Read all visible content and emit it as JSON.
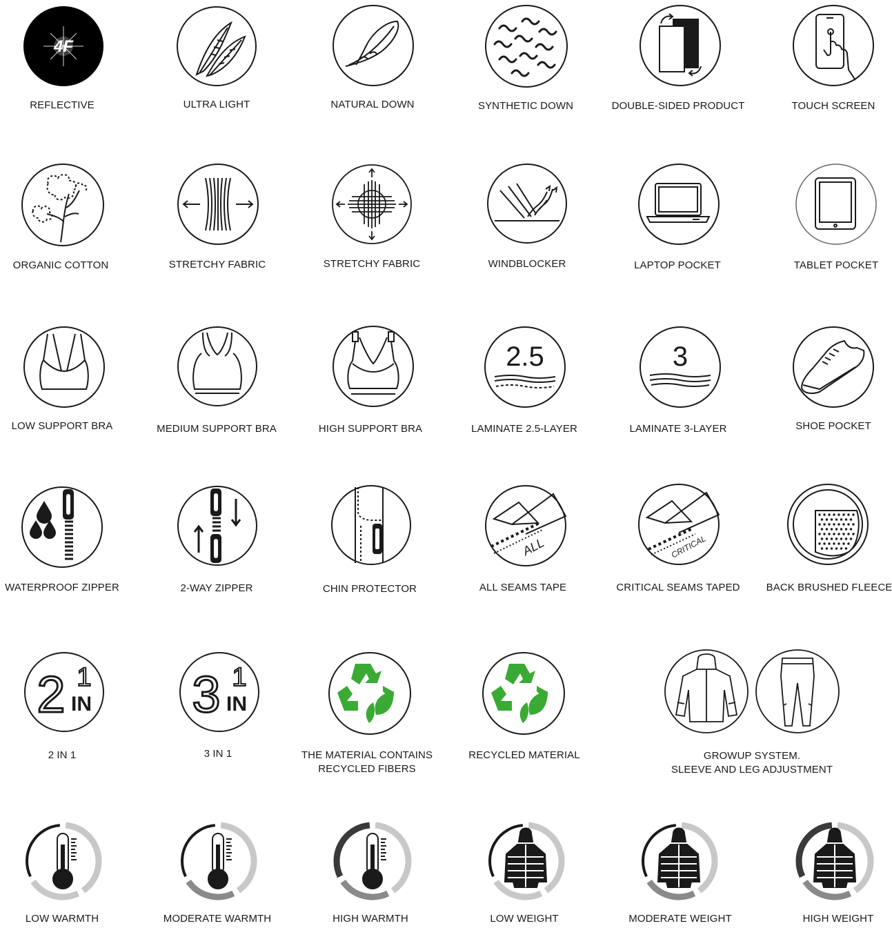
{
  "rows": [
    [
      {
        "id": "reflective",
        "label": "REFLECTIVE",
        "icon": "reflective-4f-icon"
      },
      {
        "id": "ultra-light",
        "label": "ULTRA LIGHT",
        "icon": "feathers-icon"
      },
      {
        "id": "natural-down",
        "label": "NATURAL DOWN",
        "icon": "feather-icon"
      },
      {
        "id": "synthetic-down",
        "label": "SYNTHETIC DOWN",
        "icon": "wavy-fibers-icon"
      },
      {
        "id": "double-sided",
        "label": "DOUBLE-SIDED PRODUCT",
        "icon": "double-sided-icon"
      },
      {
        "id": "touch-screen",
        "label": "TOUCH SCREEN",
        "icon": "touch-phone-icon"
      }
    ],
    [
      {
        "id": "organic-cotton",
        "label": "ORGANIC COTTON",
        "icon": "cotton-plant-icon"
      },
      {
        "id": "stretchy-fabric-1",
        "label": "STRETCHY FABRIC",
        "icon": "stretch-horizontal-icon"
      },
      {
        "id": "stretchy-fabric-2",
        "label": "STRETCHY FABRIC",
        "icon": "stretch-fourway-icon"
      },
      {
        "id": "windblocker",
        "label": "WINDBLOCKER",
        "icon": "wind-deflect-icon"
      },
      {
        "id": "laptop-pocket",
        "label": "LAPTOP POCKET",
        "icon": "laptop-icon"
      },
      {
        "id": "tablet-pocket",
        "label": "TABLET POCKET",
        "icon": "tablet-icon"
      }
    ],
    [
      {
        "id": "low-support-bra",
        "label": "LOW SUPPORT BRA",
        "icon": "bra-low-icon"
      },
      {
        "id": "medium-support-bra",
        "label": "MEDIUM SUPPORT BRA",
        "icon": "bra-medium-icon"
      },
      {
        "id": "high-support-bra",
        "label": "HIGH SUPPORT BRA",
        "icon": "bra-high-icon"
      },
      {
        "id": "laminate-2-5",
        "label": "LAMINATE 2.5-LAYER",
        "icon": "laminate-icon",
        "badge": "2.5"
      },
      {
        "id": "laminate-3",
        "label": "LAMINATE 3-LAYER",
        "icon": "laminate-icon",
        "badge": "3"
      },
      {
        "id": "shoe-pocket",
        "label": "SHOE POCKET",
        "icon": "shoe-icon"
      }
    ],
    [
      {
        "id": "waterproof-zipper",
        "label": "WATERPROOF ZIPPER",
        "icon": "waterproof-zipper-icon"
      },
      {
        "id": "two-way-zipper",
        "label": "2-WAY ZIPPER",
        "icon": "two-way-zipper-icon"
      },
      {
        "id": "chin-protector",
        "label": "CHIN PROTECTOR",
        "icon": "chin-protector-icon"
      },
      {
        "id": "all-seams-tape",
        "label": "ALL SEAMS TAPE",
        "icon": "seams-tape-icon",
        "badge": "ALL"
      },
      {
        "id": "critical-seams",
        "label": "CRITICAL SEAMS TAPED",
        "icon": "seams-tape-icon",
        "badge": "CRITICAL"
      },
      {
        "id": "back-brushed-fleece",
        "label": "BACK BRUSHED FLEECE",
        "icon": "fleece-icon"
      }
    ],
    [
      {
        "id": "two-in-one",
        "label": "2 IN 1",
        "icon": "in-one-icon",
        "badge": "2"
      },
      {
        "id": "three-in-one",
        "label": "3 IN 1",
        "icon": "in-one-icon",
        "badge": "3"
      },
      {
        "id": "recycled-fibers",
        "label": "THE MATERIAL CONTAINS RECYCLED FIBERS",
        "icon": "recycle-leaf-icon"
      },
      {
        "id": "recycled-material",
        "label": "RECYCLED MATERIAL",
        "icon": "recycle-leaf-icon"
      },
      {
        "id": "growup",
        "label": "GROWUP SYSTEM. SLEEVE AND LEG ADJUSTMENT",
        "icon": "jacket-pants-icon"
      }
    ],
    [
      {
        "id": "low-warmth",
        "label": "LOW WARMTH",
        "icon": "thermometer-icon",
        "level": 1
      },
      {
        "id": "moderate-warmth",
        "label": "MODERATE WARMTH",
        "icon": "thermometer-icon",
        "level": 2
      },
      {
        "id": "high-warmth",
        "label": "HIGH WARMTH",
        "icon": "thermometer-icon",
        "level": 3
      },
      {
        "id": "low-weight",
        "label": "LOW WEIGHT",
        "icon": "puffer-icon",
        "level": 1
      },
      {
        "id": "moderate-weight",
        "label": "MODERATE WEIGHT",
        "icon": "puffer-icon",
        "level": 2
      },
      {
        "id": "high-weight",
        "label": "HIGH WEIGHT",
        "icon": "puffer-icon",
        "level": 3
      }
    ]
  ],
  "labels": {
    "reflective": "REFLECTIVE",
    "ultra_light": "ULTRA LIGHT",
    "natural_down": "NATURAL DOWN",
    "synthetic_down": "SYNTHETIC DOWN",
    "double_sided": "DOUBLE-SIDED PRODUCT",
    "touch_screen": "TOUCH SCREEN",
    "organic_cotton": "ORGANIC COTTON",
    "stretchy_fabric_1": "STRETCHY FABRIC",
    "stretchy_fabric_2": "STRETCHY FABRIC",
    "windblocker": "WINDBLOCKER",
    "laptop_pocket": "LAPTOP POCKET",
    "tablet_pocket": "TABLET POCKET",
    "low_support_bra": "LOW SUPPORT BRA",
    "medium_support_bra": "MEDIUM SUPPORT BRA",
    "high_support_bra": "HIGH SUPPORT BRA",
    "laminate_2_5": "LAMINATE 2.5-LAYER",
    "laminate_3": "LAMINATE 3-LAYER",
    "shoe_pocket": "SHOE POCKET",
    "waterproof_zipper": "WATERPROOF ZIPPER",
    "two_way_zipper": "2-WAY ZIPPER",
    "chin_protector": "CHIN PROTECTOR",
    "all_seams_tape": "ALL SEAMS TAPE",
    "critical_seams": "CRITICAL SEAMS TAPED",
    "back_brushed_fleece": "BACK BRUSHED FLEECE",
    "two_in_one": "2 IN 1",
    "three_in_one": "3 IN 1",
    "recycled_fibers_1": "THE MATERIAL CONTAINS",
    "recycled_fibers_2": "RECYCLED FIBERS",
    "recycled_material": "RECYCLED MATERIAL",
    "growup_1": "GROWUP SYSTEM.",
    "growup_2": "SLEEVE AND LEG ADJUSTMENT",
    "low_warmth": "LOW WARMTH",
    "moderate_warmth": "MODERATE WARMTH",
    "high_warmth": "HIGH WARMTH",
    "low_weight": "LOW WEIGHT",
    "moderate_weight": "MODERATE WEIGHT",
    "high_weight": "HIGH WEIGHT"
  },
  "badges": {
    "brand": "4F",
    "laminate_2_5": "2.5",
    "laminate_3": "3",
    "all": "ALL",
    "critical": "CRITICAL",
    "two": "2",
    "three": "3",
    "one": "1",
    "in": "IN"
  },
  "levels": {
    "low": 1,
    "moderate": 2,
    "high": 3,
    "max": 3
  },
  "colors": {
    "ink": "#1a1a1a",
    "recycle_green": "#3aaa35",
    "ring_light": "#c8c8c8",
    "ring_mid": "#8a8a8a",
    "ring_dark": "#3a3a3a",
    "reflective_bg": "#000000"
  }
}
